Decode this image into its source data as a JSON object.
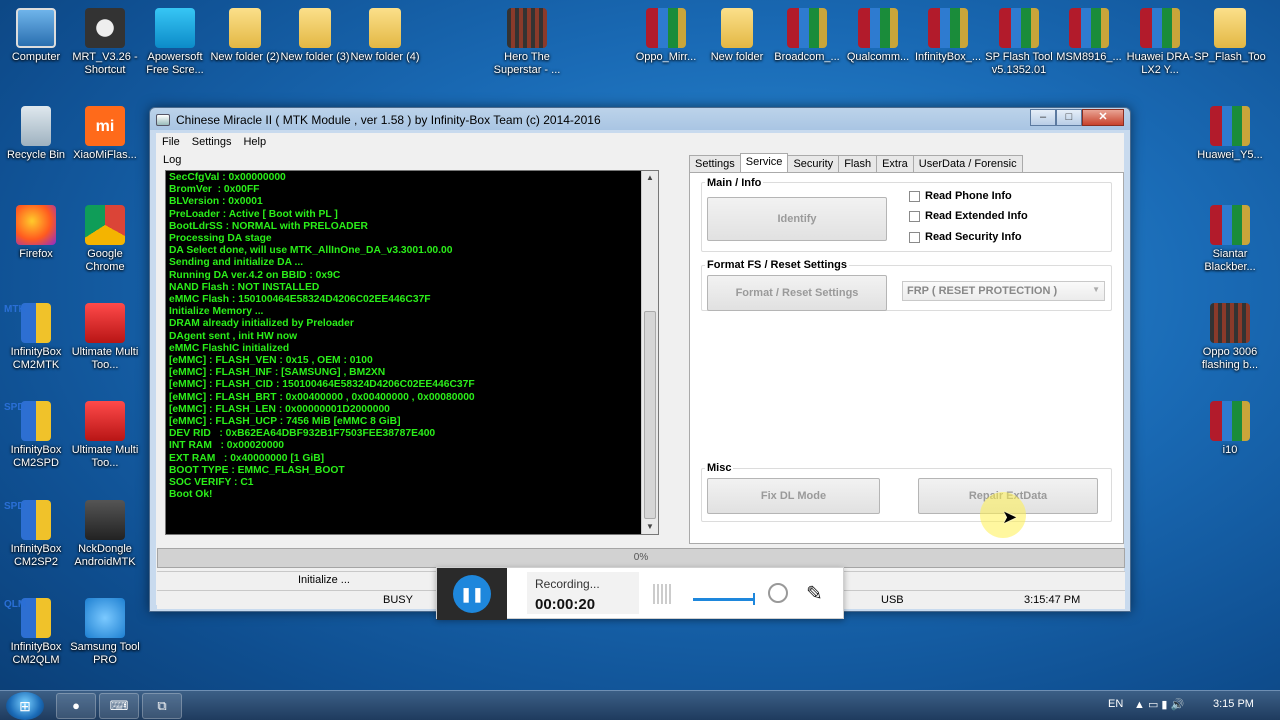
{
  "desktop_icons": [
    {
      "label": "Computer",
      "icon": "computer-icon"
    },
    {
      "label": "MRT_V3.26 - Shortcut",
      "icon": "mrt-icon"
    },
    {
      "label": "Apowersoft Free Scre...",
      "icon": "recorder-icon"
    },
    {
      "label": "New folder (2)",
      "icon": "folder-icon"
    },
    {
      "label": "New folder (3)",
      "icon": "folder-icon"
    },
    {
      "label": "New folder (4)",
      "icon": "folder-icon"
    },
    {
      "label": "Hero The Superstar - ...",
      "icon": "video-icon"
    },
    {
      "label": "Oppo_Mirr...",
      "icon": "winrar-icon"
    },
    {
      "label": "New folder",
      "icon": "folder-icon"
    },
    {
      "label": "Broadcom_...",
      "icon": "winrar-icon"
    },
    {
      "label": "Qualcomm...",
      "icon": "winrar-icon"
    },
    {
      "label": "InfinityBox_...",
      "icon": "winrar-icon"
    },
    {
      "label": "SP Flash Tool v5.1352.01",
      "icon": "winrar-icon"
    },
    {
      "label": "MSM8916_...",
      "icon": "winrar-icon"
    },
    {
      "label": "Huawei DRA-LX2 Y...",
      "icon": "winrar-icon"
    },
    {
      "label": "SP_Flash_Too",
      "icon": "folder-icon"
    },
    {
      "label": "Recycle Bin",
      "icon": "recycle-bin-icon"
    },
    {
      "label": "XiaoMiFlas...",
      "icon": "xiaomi-icon"
    },
    {
      "label": "Huawei_Y5...",
      "icon": "winrar-icon"
    },
    {
      "label": "Firefox",
      "icon": "firefox-icon"
    },
    {
      "label": "Google Chrome",
      "icon": "chrome-icon"
    },
    {
      "label": "Siantar Blackber...",
      "icon": "winrar-icon"
    },
    {
      "label": "InfinityBox CM2MTK",
      "icon": "infinitybox-icon",
      "tag": "MTK"
    },
    {
      "label": "Ultimate Multi Too...",
      "icon": "ultimate-multi-tool-icon"
    },
    {
      "label": "Oppo 3006 flashing b...",
      "icon": "video-icon"
    },
    {
      "label": "InfinityBox CM2SPD",
      "icon": "infinitybox-icon",
      "tag": "SPD"
    },
    {
      "label": "Ultimate Multi Too...",
      "icon": "ultimate-multi-tool-icon"
    },
    {
      "label": "i10",
      "icon": "winrar-icon"
    },
    {
      "label": "InfinityBox CM2SP2",
      "icon": "infinitybox-icon",
      "tag": "SPD"
    },
    {
      "label": "NckDongle AndroidMTK",
      "icon": "nck-dongle-icon"
    },
    {
      "label": "InfinityBox CM2QLM",
      "icon": "infinitybox-icon",
      "tag": "QLM"
    },
    {
      "label": "Samsung Tool PRO",
      "icon": "samsung-tool-icon"
    }
  ],
  "window": {
    "title": "Chinese Miracle II ( MTK Module , ver 1.58 ) by Infinity-Box Team (c) 2014-2016",
    "menu": [
      "File",
      "Settings",
      "Help"
    ],
    "log_label": "Log",
    "log_lines": [
      "SecCfgVal : 0x00000000",
      "BromVer  : 0x00FF",
      "BLVersion : 0x0001",
      "PreLoader : Active [ Boot with PL ]",
      "BootLdrSS : NORMAL with PRELOADER",
      "Processing DA stage",
      "DA Select done, will use MTK_AllInOne_DA_v3.3001.00.00",
      "Sending and initialize DA ...",
      "Running DA ver.4.2 on BBID : 0x9C",
      "NAND Flash : NOT INSTALLED",
      "eMMC Flash : 150100464E58324D4206C02EE446C37F",
      "Initialize Memory ...",
      "DRAM already initialized by Preloader",
      "DAgent sent , init HW now",
      "eMMC FlashIC initialized",
      "[eMMC] : FLASH_VEN : 0x15 , OEM : 0100",
      "[eMMC] : FLASH_INF : [SAMSUNG] , BM2XN",
      "[eMMC] : FLASH_CID : 150100464E58324D4206C02EE446C37F",
      "[eMMC] : FLASH_BRT : 0x00400000 , 0x00400000 , 0x00080000",
      "[eMMC] : FLASH_LEN : 0x00000001D2000000",
      "[eMMC] : FLASH_UCP : 7456 MiB [eMMC 8 GiB]",
      "DEV RID   : 0xB62EA64DBF932B1F7503FEE38787E400",
      "INT RAM   : 0x00020000",
      "EXT RAM   : 0x40000000 [1 GiB]",
      "BOOT TYPE : EMMC_FLASH_BOOT",
      "SOC VERIFY : C1",
      "Boot Ok!"
    ],
    "tabs": [
      "Settings",
      "Service",
      "Security",
      "Flash",
      "Extra",
      "UserData / Forensic"
    ],
    "active_tab": "Service",
    "service": {
      "main_info_title": "Main / Info",
      "identify_label": "Identify",
      "checkboxes": [
        "Read Phone Info",
        "Read Extended Info",
        "Read Security Info"
      ],
      "format_title": "Format FS / Reset Settings",
      "format_button": "Format / Reset Settings",
      "frp_select": "FRP ( RESET PROTECTION )",
      "misc_title": "Misc",
      "fix_dl_label": "Fix DL Mode",
      "repair_ext_label": "Repair ExtData"
    },
    "progress_text": "0%",
    "progress": 0,
    "status": {
      "initialize": "Initialize ...",
      "busy": "BUSY",
      "usb": "USB",
      "time": "3:15:47 PM"
    }
  },
  "recorder": {
    "label": "Recording...",
    "time": "00:00:20"
  },
  "taskbar": {
    "lang": "EN",
    "clock": "3:15 PM"
  }
}
